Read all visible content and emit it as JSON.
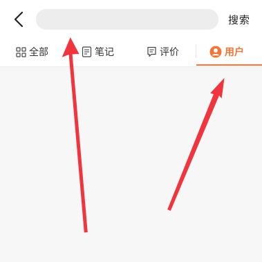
{
  "header": {
    "search_placeholder": "",
    "search_label": "搜索"
  },
  "tabs": [
    {
      "label": "全部",
      "icon": "grid-icon",
      "active": false
    },
    {
      "label": "笔记",
      "icon": "note-icon",
      "active": false
    },
    {
      "label": "评价",
      "icon": "comment-icon",
      "active": false
    },
    {
      "label": "用户",
      "icon": "user-icon",
      "active": true
    }
  ],
  "colors": {
    "accent": "#f2753a",
    "annotation_arrow": "#f0353f"
  }
}
